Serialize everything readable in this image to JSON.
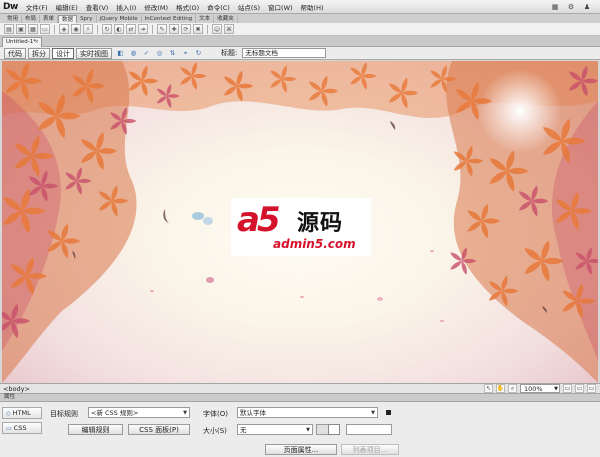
{
  "app": {
    "logo": "Dw"
  },
  "menubar": {
    "items": [
      "文件(F)",
      "编辑(E)",
      "查看(V)",
      "插入(I)",
      "修改(M)",
      "格式(O)",
      "命令(C)",
      "站点(S)",
      "窗口(W)",
      "帮助(H)"
    ],
    "right_icons": [
      "layout-icon",
      "gear-icon",
      "user-icon"
    ]
  },
  "insert_bar": {
    "tabs": [
      "常用",
      "布局",
      "表单",
      "数据",
      "Spry",
      "jQuery Mobile",
      "InContext Editing",
      "文本",
      "收藏夹"
    ],
    "active_index": 3
  },
  "document": {
    "tab_label": "Untitled-1*"
  },
  "doc_toolbar": {
    "views": [
      "代码",
      "拆分",
      "设计",
      "实时视图"
    ],
    "active_view": 2,
    "title_label": "标题:",
    "title_value": "无标题文档"
  },
  "canvas": {
    "logo_a5": "a5",
    "logo_cn": "源码",
    "logo_url": "admin5.com",
    "colors": {
      "logo_red": "#d5122c",
      "leaf_orange": "#e8793a",
      "leaf_pink": "#c8506a"
    }
  },
  "statusbar": {
    "tag": "<body>",
    "zoom": "100%"
  },
  "properties": {
    "header": "属性",
    "html_btn": "HTML",
    "css_btn": "CSS",
    "target_rule_label": "目标规则",
    "target_rule_value": "<新 CSS 规则>",
    "edit_rule_btn": "编辑规则",
    "css_panel_btn": "CSS 面板(P)",
    "font_label": "字体(O)",
    "font_value": "默认字体",
    "size_label": "大小(S)",
    "size_value": "无",
    "page_props_btn": "页面属性...",
    "list_item_btn": "列表项目..."
  }
}
